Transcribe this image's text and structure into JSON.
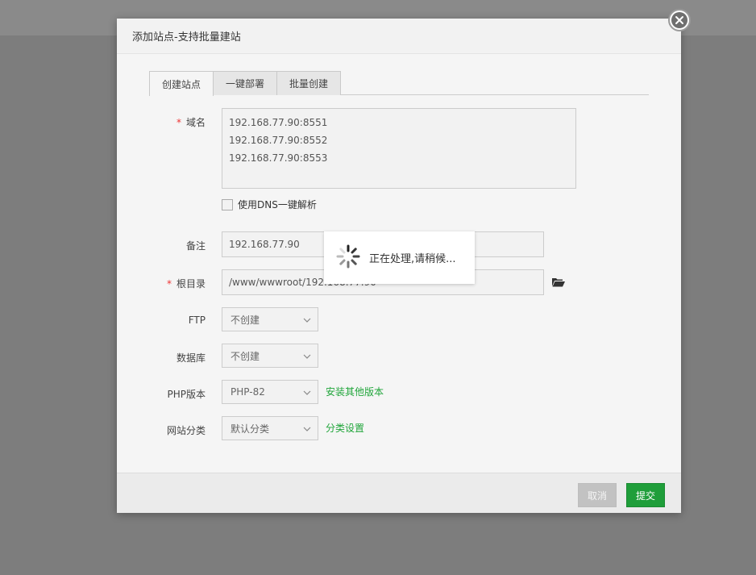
{
  "dialog": {
    "title": "添加站点-支持批量建站",
    "close_icon": "close-icon"
  },
  "tabs": [
    {
      "label": "创建站点",
      "active": true
    },
    {
      "label": "一键部署",
      "active": false
    },
    {
      "label": "批量创建",
      "active": false
    }
  ],
  "form": {
    "domain": {
      "label": "域名",
      "required_mark": "*",
      "lines": [
        "192.168.77.90:8551",
        "192.168.77.90:8552",
        "192.168.77.90:8553"
      ]
    },
    "dns_checkbox": {
      "label": "使用DNS一键解析",
      "checked": false
    },
    "remark": {
      "label": "备注",
      "value": "192.168.77.90"
    },
    "root_dir": {
      "label": "根目录",
      "required_mark": "*",
      "value": "/www/wwwroot/192.168.77.90",
      "icon": "folder-open-icon"
    },
    "ftp": {
      "label": "FTP",
      "value": "不创建"
    },
    "database": {
      "label": "数据库",
      "value": "不创建"
    },
    "php": {
      "label": "PHP版本",
      "value": "PHP-82",
      "link": "安装其他版本"
    },
    "category": {
      "label": "网站分类",
      "value": "默认分类",
      "link": "分类设置"
    }
  },
  "footer": {
    "cancel_label": "取消",
    "submit_label": "提交"
  },
  "loading": {
    "text": "正在处理,请稍候...",
    "icon": "spinner-icon"
  },
  "colors": {
    "accent_green": "#20a53a",
    "submit_bg": "#1f9e3a",
    "required_red": "#ee3333"
  }
}
